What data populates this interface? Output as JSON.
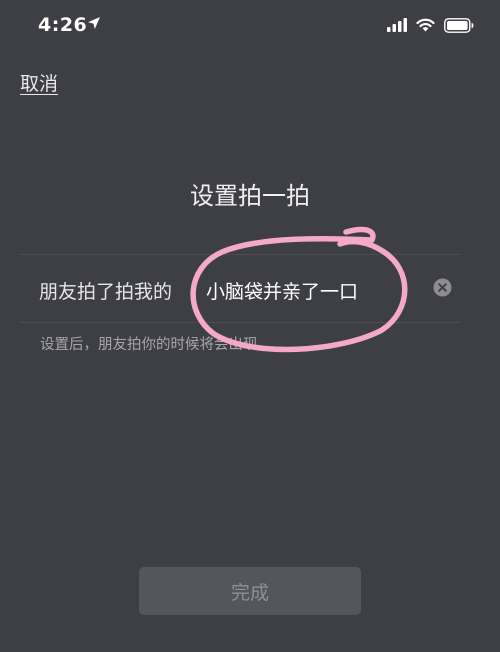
{
  "status_bar": {
    "time": "4:26",
    "icons": [
      "location-arrow-icon",
      "signal-icon",
      "wifi-icon",
      "battery-icon"
    ]
  },
  "header": {
    "cancel_label": "取消"
  },
  "main": {
    "title": "设置拍一拍",
    "field": {
      "prefix": "朋友拍了拍我的",
      "value": "小脑袋并亲了一口",
      "clear_icon": "clear-circle-icon"
    },
    "hint": "设置后，朋友拍你的时候将会出现"
  },
  "footer": {
    "done_label": "完成"
  },
  "colors": {
    "background": "#3e3e45",
    "annotation": "#f4a9c6",
    "button_bg": "#55565d",
    "button_text": "#8f9096"
  }
}
